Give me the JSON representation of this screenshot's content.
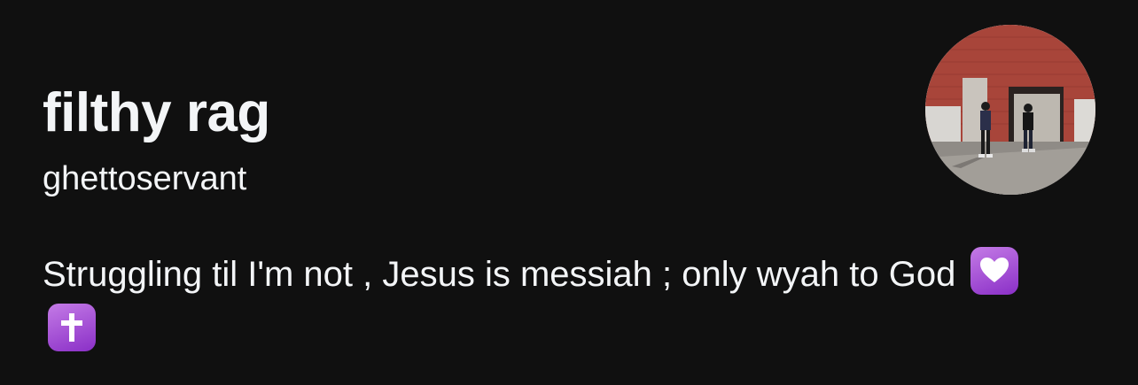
{
  "profile": {
    "display_name": "filthy rag",
    "username": "ghettoservant",
    "bio_text": "Struggling til I'm not , Jesus is messiah ; only wyah to God",
    "bio_emojis": [
      "white-heart-emoji",
      "latin-cross-emoji"
    ],
    "avatar_icon": "profile-photo"
  },
  "colors": {
    "background": "#101010",
    "text": "#f3f5f7",
    "emoji_tile": "#9b3fd1"
  }
}
